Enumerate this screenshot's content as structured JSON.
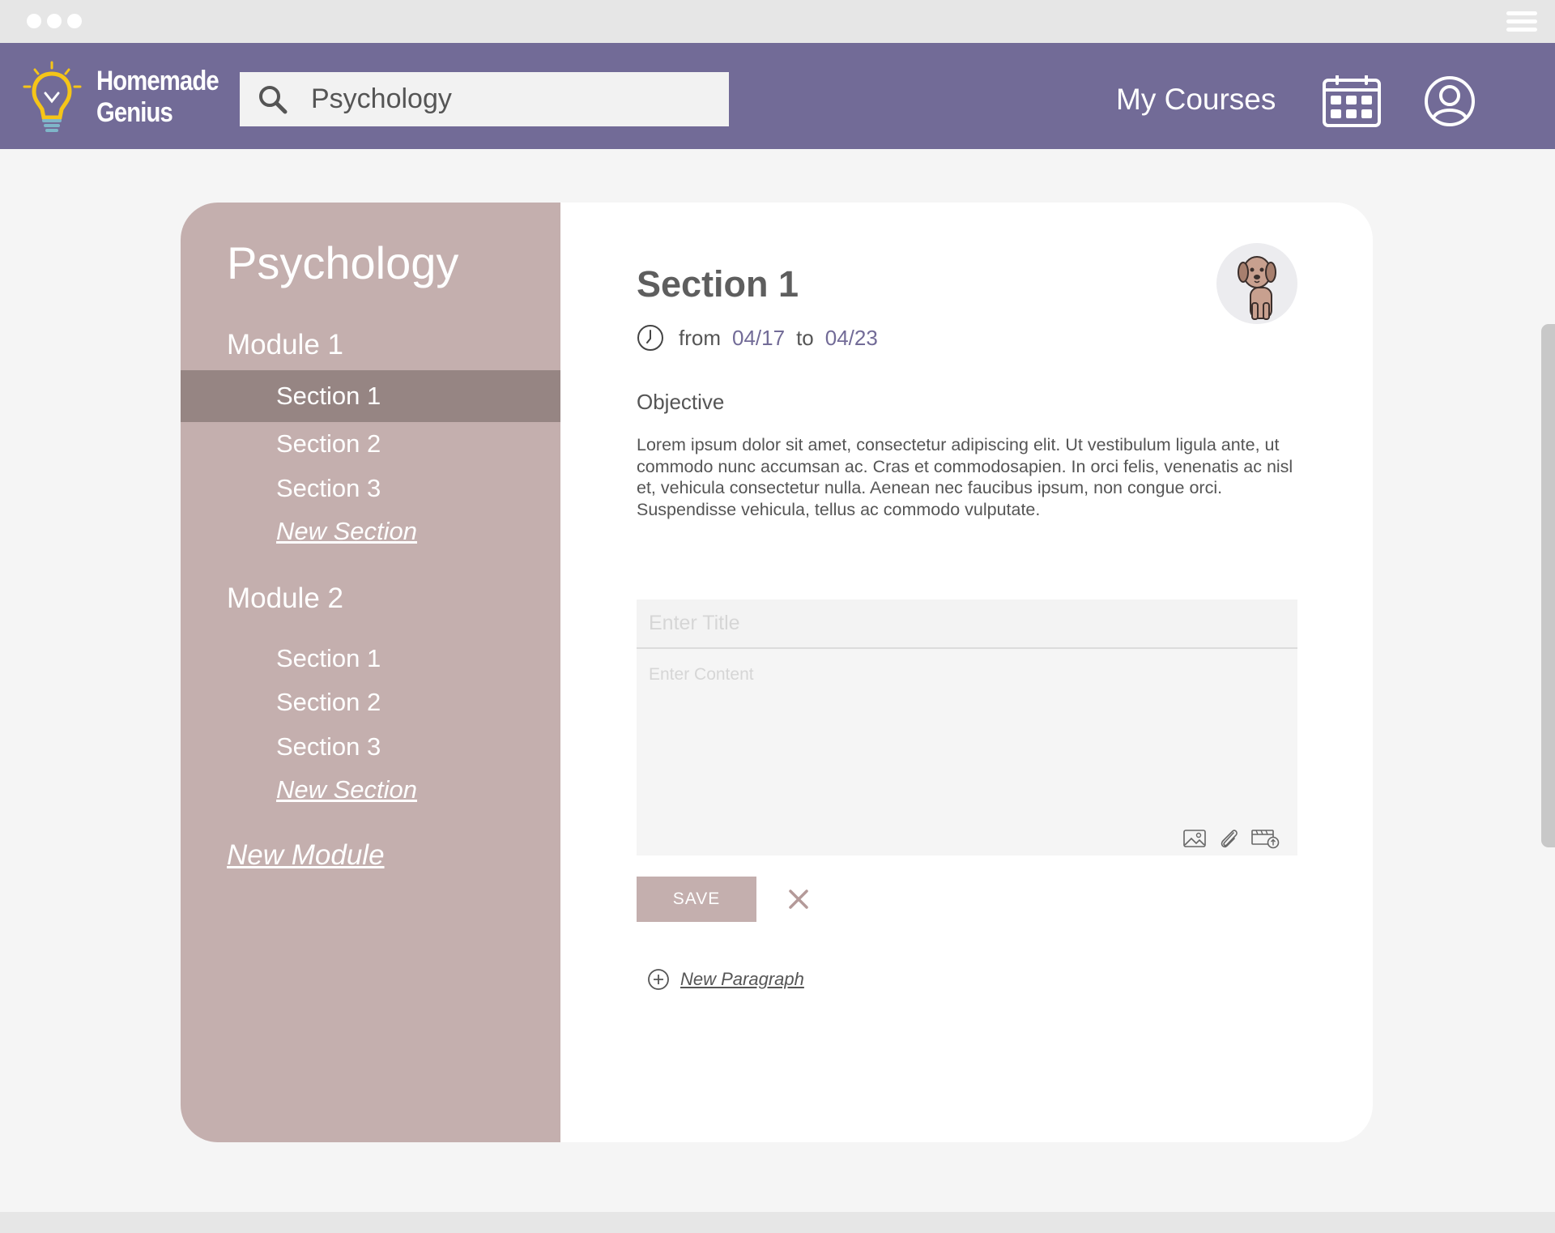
{
  "app": {
    "brand_line1": "Homemade",
    "brand_line2": "Genius",
    "accent_color": "#726b97",
    "sidebar_color": "#c4afae"
  },
  "header": {
    "search": {
      "value": "Psychology",
      "icon": "search-icon"
    },
    "nav_link": "My Courses",
    "icons": [
      "calendar-icon",
      "profile-icon"
    ]
  },
  "sidebar": {
    "course_title": "Psychology",
    "modules": [
      {
        "title": "Module 1",
        "sections": [
          "Section 1",
          "Section 2",
          "Section 3"
        ],
        "new_section_label": "New Section"
      },
      {
        "title": "Module 2",
        "sections": [
          "Section 1",
          "Section 2",
          "Section 3"
        ],
        "new_section_label": "New Section"
      }
    ],
    "active": "Module 1 / Section 1",
    "new_module_label": "New Module"
  },
  "content": {
    "section_title": "Section 1",
    "date": {
      "from_word": "from",
      "from": "04/17",
      "to_word": "to",
      "to": "04/23"
    },
    "objective_label": "Objective",
    "objective_text": "Lorem ipsum dolor sit amet, consectetur adipiscing elit. Ut vestibulum ligula ante, ut commodo nunc accumsan ac. Cras et commodosapien. In orci felis, venenatis ac nisl et, vehicula consectetur nulla. Aenean nec faucibus ipsum, non congue orci. Suspendisse vehicula, tellus ac commodo vulputate.",
    "editor": {
      "title_placeholder": "Enter Title",
      "content_placeholder": "Enter Content",
      "tools": [
        "image-icon",
        "attachment-icon",
        "video-upload-icon"
      ]
    },
    "save_label": "SAVE",
    "new_paragraph_label": "New Paragraph"
  }
}
